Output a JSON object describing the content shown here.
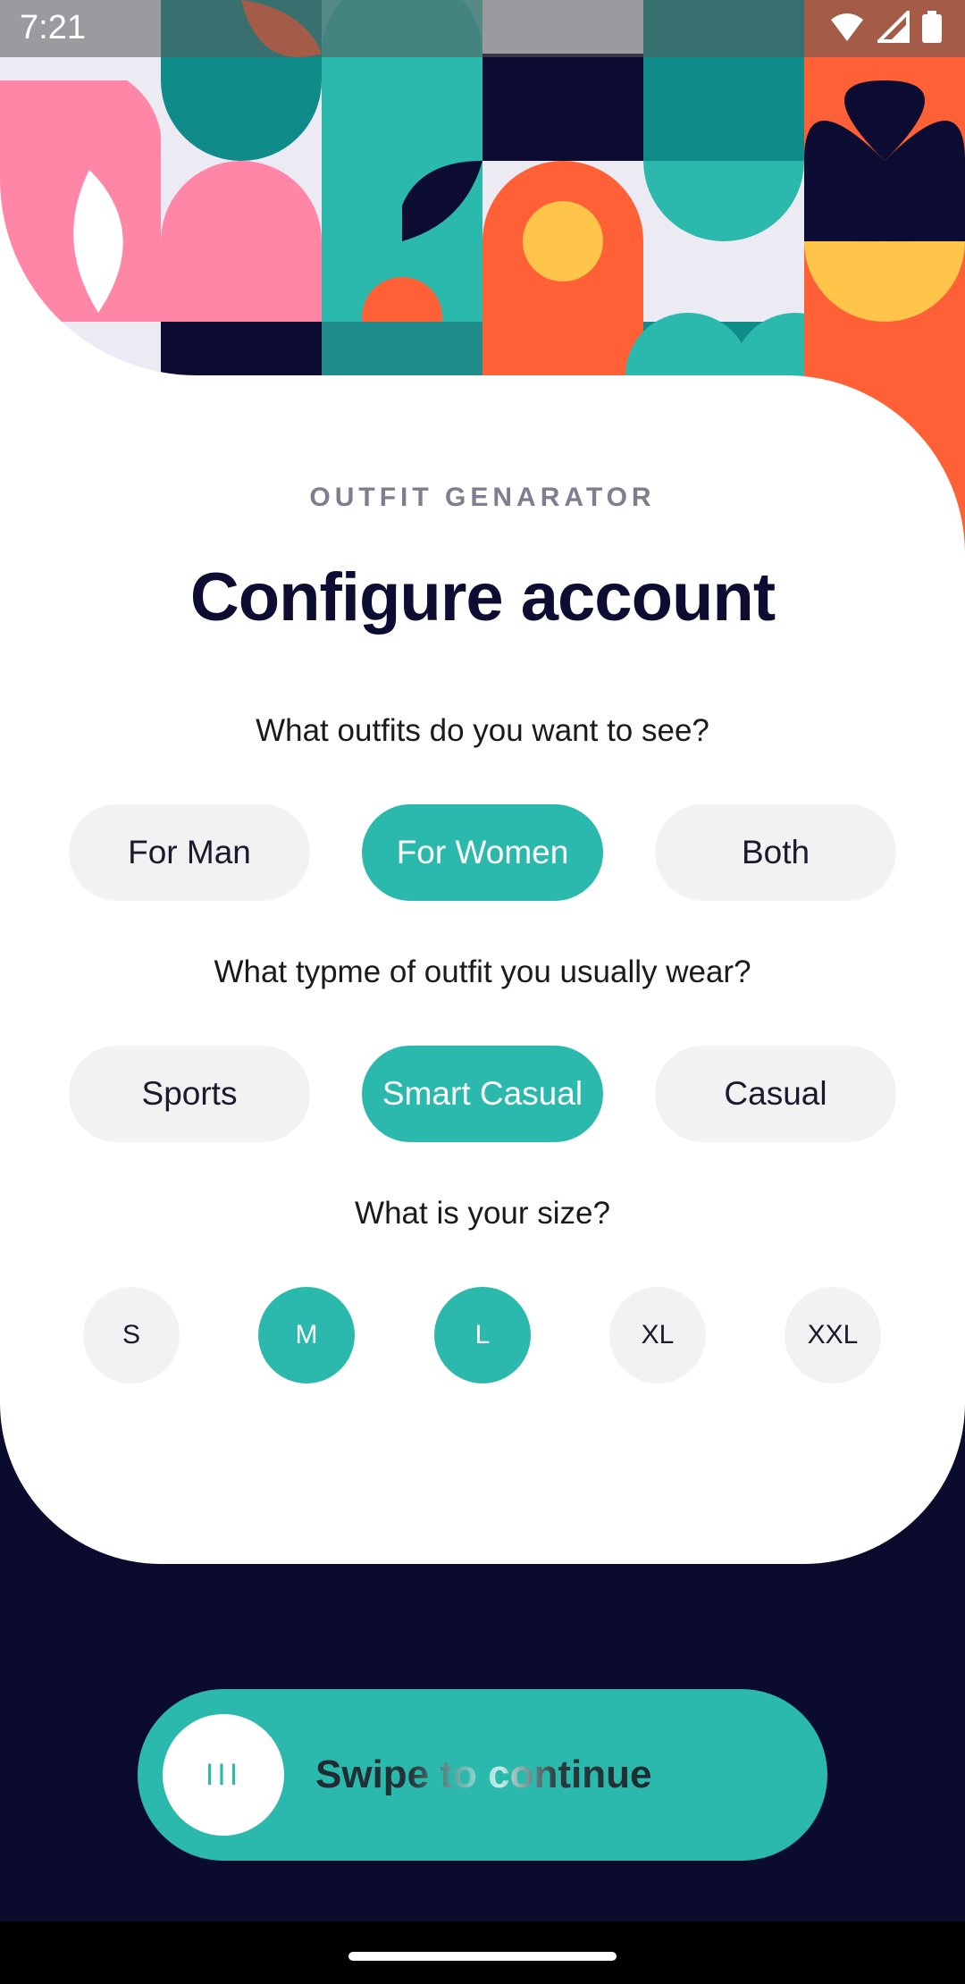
{
  "status_bar": {
    "time": "7:21"
  },
  "header": {
    "eyebrow": "OUTFIT GENARATOR",
    "title": "Configure account"
  },
  "questions": {
    "gender": {
      "label": "What outfits do you want to see?",
      "options": [
        "For Man",
        "For Women",
        "Both"
      ],
      "selected": "For Women"
    },
    "style": {
      "label": "What typme of outfit you usually wear?",
      "options": [
        "Sports",
        "Smart Casual",
        "Casual"
      ],
      "selected": "Smart Casual"
    },
    "size": {
      "label": "What is your size?",
      "options": [
        "S",
        "M",
        "L",
        "XL",
        "XXL"
      ],
      "selected": [
        "M",
        "L"
      ]
    }
  },
  "swipe": {
    "knob_icon": "III",
    "label": "Swipe to continue"
  },
  "colors": {
    "accent": "#2bb9ad",
    "navy": "#0b0b2e",
    "pill_bg": "#f2f2f2",
    "coral": "#ff6035",
    "pink": "#ff86a6",
    "yellow": "#ffc54a"
  }
}
